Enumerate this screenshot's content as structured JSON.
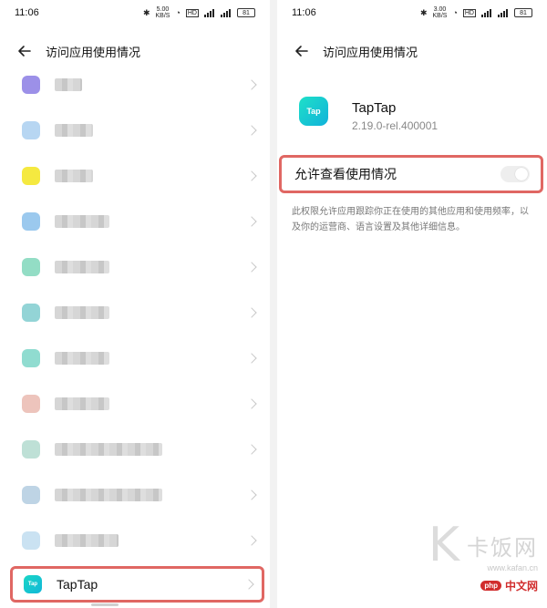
{
  "status_bar": {
    "time": "11:06",
    "net_speed_left": "5.00\nKB/S",
    "net_speed_right": "3.00\nKB/S",
    "hd_badge": "HD",
    "battery_left": "81",
    "battery_right": "81"
  },
  "left": {
    "title": "访问应用使用情况",
    "app_rows": [
      {
        "icon_color": "#7b6be0",
        "blur_width": 30
      },
      {
        "icon_color": "#9fc8ee",
        "blur_width": 42
      },
      {
        "icon_color": "#f2e100",
        "blur_width": 42
      },
      {
        "icon_color": "#7ab7e8",
        "blur_width": 60
      },
      {
        "icon_color": "#6fd2b2",
        "blur_width": 60
      },
      {
        "icon_color": "#6fc5c8",
        "blur_width": 60
      },
      {
        "icon_color": "#6bd0c0",
        "blur_width": 60
      },
      {
        "icon_color": "#e7b0a5",
        "blur_width": 60
      },
      {
        "icon_color": "#a8d6c8",
        "blur_width": 118
      },
      {
        "icon_color": "#a8c6dc",
        "blur_width": 118
      },
      {
        "icon_color": "#b8d8ee",
        "blur_width": 70
      }
    ],
    "highlight_row": {
      "icon_text": "Tap",
      "label": "TapTap"
    }
  },
  "right": {
    "title": "访问应用使用情况",
    "app_icon_text": "Tap",
    "app_name": "TapTap",
    "app_version": "2.19.0-rel.400001",
    "toggle_label": "允许查看使用情况",
    "toggle_on": false,
    "description": "此权限允许应用跟踪你正在使用的其他应用和使用频率，以及你的运营商、语言设置及其他详细信息。"
  },
  "watermark": {
    "brand_cn": "卡饭网",
    "url": "www.kafan.cn",
    "php_badge": "php",
    "php_cn": "中文网"
  },
  "colors": {
    "highlight_border": "#e06763",
    "taptap_gradient_start": "#1ee0c8",
    "taptap_gradient_end": "#11b2da"
  }
}
